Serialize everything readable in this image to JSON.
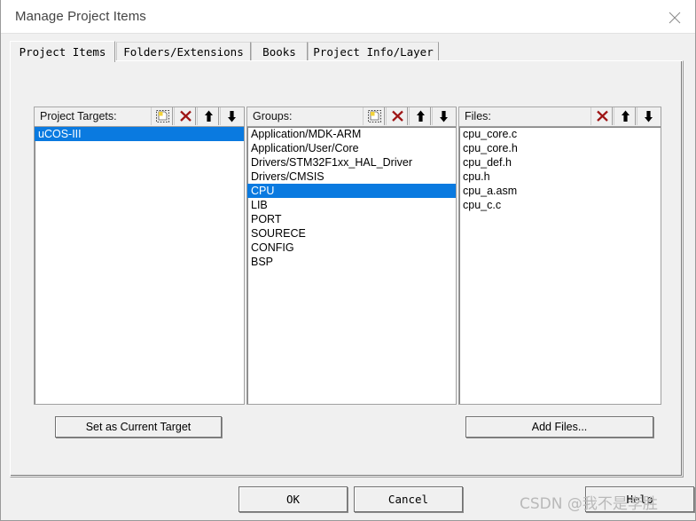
{
  "window": {
    "title": "Manage Project Items",
    "close_icon": "close-icon"
  },
  "tabs": [
    {
      "label": "Project Items",
      "active": true
    },
    {
      "label": "Folders/Extensions",
      "active": false
    },
    {
      "label": "Books",
      "active": false
    },
    {
      "label": "Project Info/Layer",
      "active": false
    }
  ],
  "columns": {
    "targets": {
      "label": "Project Targets:",
      "icons": [
        "new-item-icon",
        "delete-icon",
        "move-up-icon",
        "move-down-icon"
      ],
      "items": [
        {
          "label": "uCOS-III",
          "selected": true
        }
      ]
    },
    "groups": {
      "label": "Groups:",
      "icons": [
        "new-item-icon",
        "delete-icon",
        "move-up-icon",
        "move-down-icon"
      ],
      "items": [
        {
          "label": "Application/MDK-ARM",
          "selected": false
        },
        {
          "label": "Application/User/Core",
          "selected": false
        },
        {
          "label": "Drivers/STM32F1xx_HAL_Driver",
          "selected": false
        },
        {
          "label": "Drivers/CMSIS",
          "selected": false
        },
        {
          "label": "CPU",
          "selected": true
        },
        {
          "label": "LIB",
          "selected": false
        },
        {
          "label": "PORT",
          "selected": false
        },
        {
          "label": "SOURECE",
          "selected": false
        },
        {
          "label": "CONFIG",
          "selected": false
        },
        {
          "label": "BSP",
          "selected": false
        }
      ]
    },
    "files": {
      "label": "Files:",
      "icons": [
        "delete-icon",
        "move-up-icon",
        "move-down-icon"
      ],
      "items": [
        {
          "label": "cpu_core.c",
          "selected": false
        },
        {
          "label": "cpu_core.h",
          "selected": false
        },
        {
          "label": "cpu_def.h",
          "selected": false
        },
        {
          "label": "cpu.h",
          "selected": false
        },
        {
          "label": "cpu_a.asm",
          "selected": false
        },
        {
          "label": "cpu_c.c",
          "selected": false
        }
      ]
    }
  },
  "actions": {
    "set_current_target": "Set as Current Target",
    "add_files": "Add Files..."
  },
  "footer": {
    "ok": "OK",
    "cancel": "Cancel",
    "help": "Help"
  },
  "watermark": {
    "text": "CSDN @我不是李胜"
  },
  "colors": {
    "selection_blue": "#0a7ae0",
    "delete_red": "#a01818",
    "dialog_bg": "#f0f0f0",
    "list_bg": "#ffffff"
  }
}
